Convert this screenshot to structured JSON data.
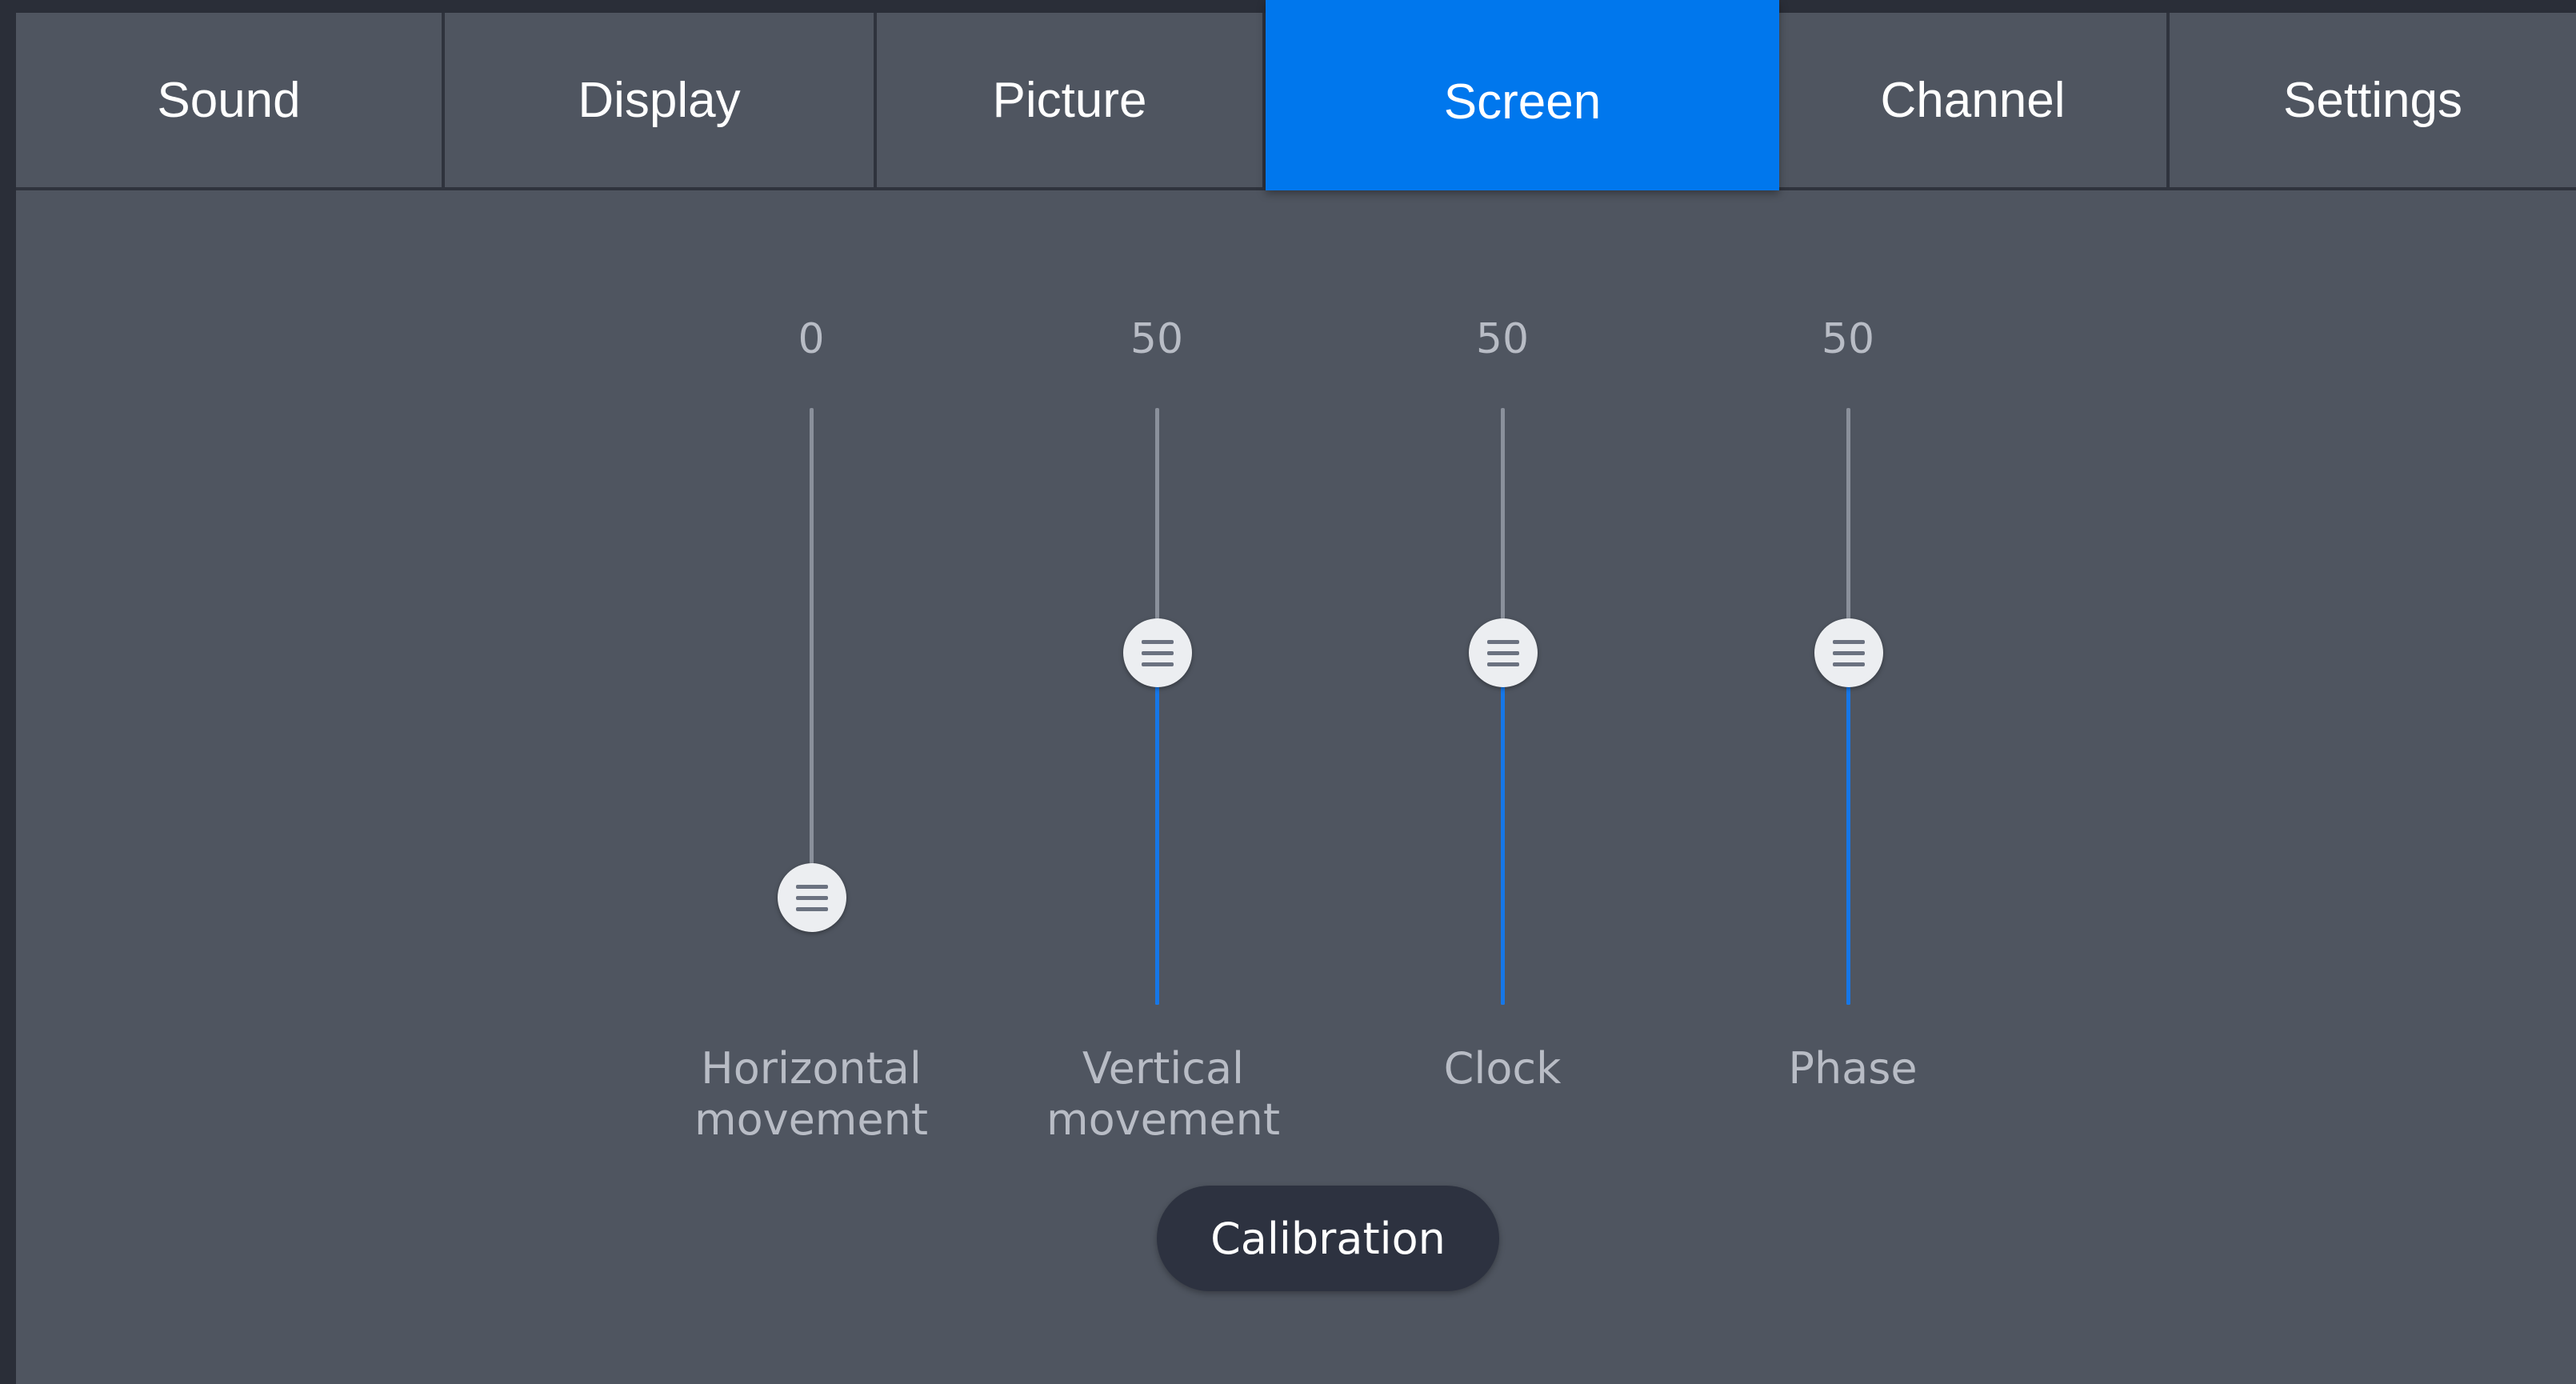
{
  "tabs": [
    {
      "label": "Sound",
      "active": false
    },
    {
      "label": "Display",
      "active": false
    },
    {
      "label": "Picture",
      "active": false
    },
    {
      "label": "Screen",
      "active": true
    },
    {
      "label": "Channel",
      "active": false
    },
    {
      "label": "Settings",
      "active": false
    }
  ],
  "sliders": [
    {
      "value": "0",
      "level": 0.0,
      "label_line1": "Horizontal",
      "label_line2": "movement"
    },
    {
      "value": "50",
      "level": 0.5,
      "label_line1": "Vertical",
      "label_line2": "movement"
    },
    {
      "value": "50",
      "level": 0.5,
      "label_line1": "Clock",
      "label_line2": ""
    },
    {
      "value": "50",
      "level": 0.5,
      "label_line1": "Phase",
      "label_line2": ""
    }
  ],
  "calibration_button": "Calibration",
  "colors": {
    "accent": "#0077ed",
    "track_fill": "#1677e8",
    "panel": "#4f5560",
    "button": "#2d3240"
  },
  "icons": {
    "slider_thumb": "drag-handle-icon"
  }
}
